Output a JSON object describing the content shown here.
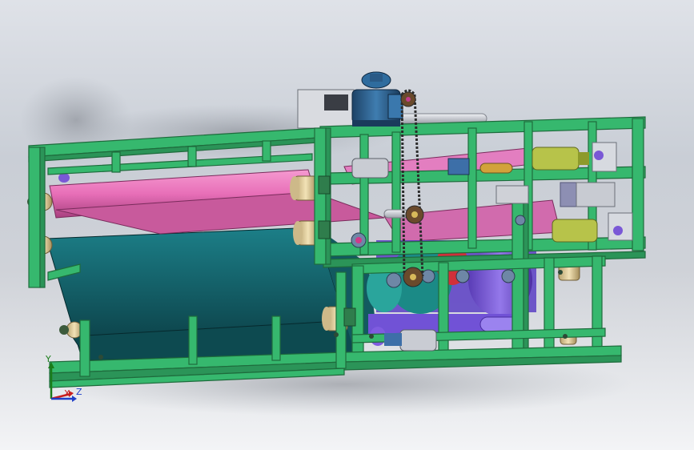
{
  "view": {
    "background_top": "#dfe2e8",
    "background_bottom": "#f3f4f6"
  },
  "model": {
    "colors": {
      "frame": "#36b86e",
      "frame_edge": "#1e6b3c",
      "belt_upper": "#e86fb8",
      "belt_lower": "#0f4f57",
      "roller_cap": "#e6d3a3",
      "motor_body": "#2c5f8a",
      "chain": "#3a3a3a",
      "purple_roll": "#7a58d6",
      "teal_roll": "#1b8a86",
      "red_roll": "#d1303a",
      "gearmotor": "#b7c34a",
      "steel": "#c9ccd3"
    },
    "components": [
      "steel-frame",
      "upper-press-belt",
      "lower-filter-belt",
      "drive-gearmotor",
      "chain-drive",
      "press-rollers",
      "tensioning-cylinders",
      "base-rails"
    ]
  },
  "triad": {
    "y_label": "Y",
    "x_label": "X",
    "z_label": "Z",
    "y_color": "#1a7d1a",
    "x_color": "#c81f1f",
    "z_color": "#1f3fc8"
  }
}
